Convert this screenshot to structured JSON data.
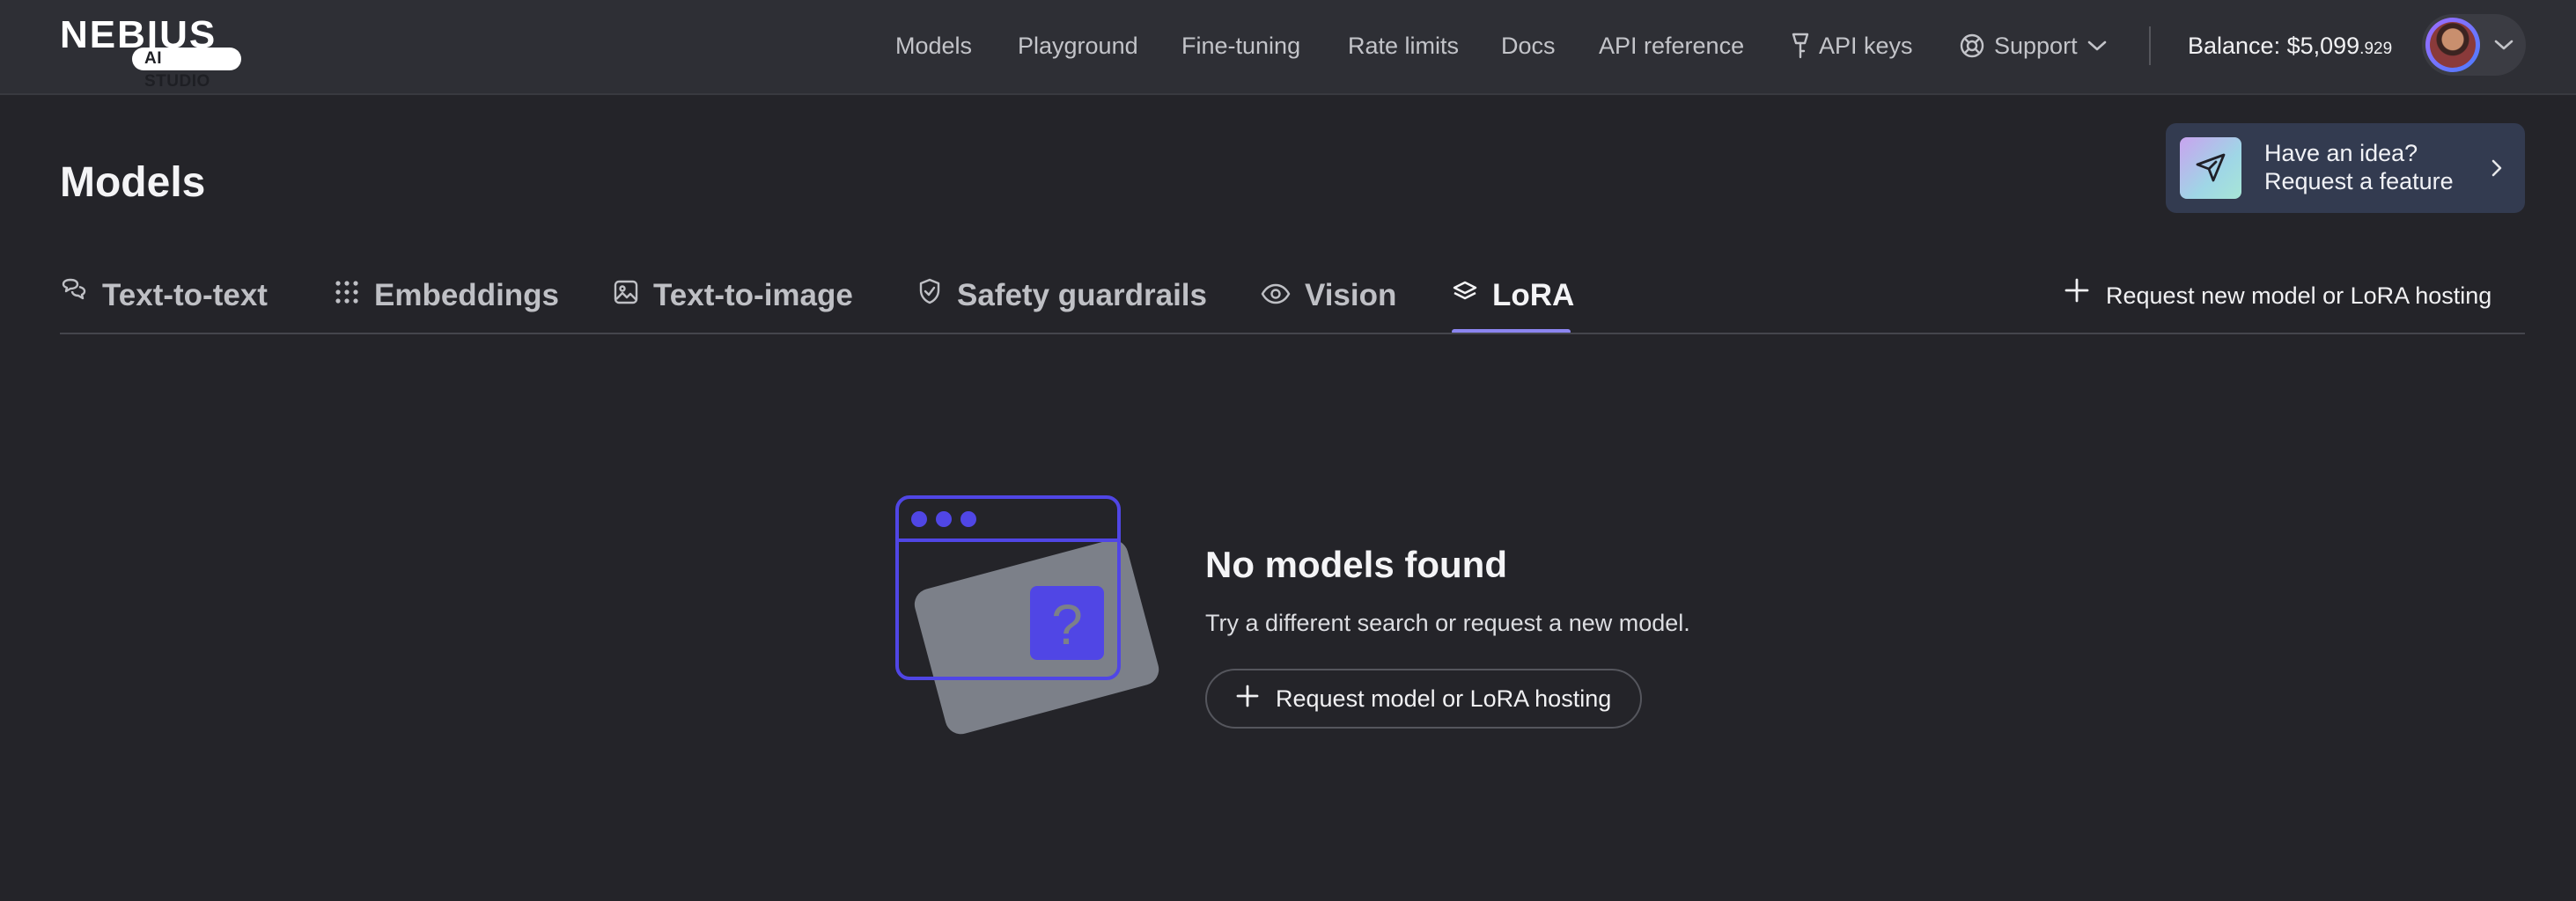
{
  "brand": {
    "name": "NEBIUS",
    "badge": "AI STUDIO"
  },
  "nav": {
    "models": "Models",
    "playground": "Playground",
    "fine_tuning": "Fine-tuning",
    "rate_limits": "Rate limits",
    "docs": "Docs",
    "api_reference": "API reference",
    "api_keys": "API keys",
    "support": "Support"
  },
  "account": {
    "balance_label": "Balance: $5,099",
    "balance_cents": ".929"
  },
  "feature_card": {
    "line1": "Have an idea?",
    "line2": "Request a feature"
  },
  "page": {
    "title": "Models"
  },
  "tabs": [
    {
      "label": "Text-to-text",
      "icon": "chat-bubbles-icon"
    },
    {
      "label": "Embeddings",
      "icon": "grid-dots-icon"
    },
    {
      "label": "Text-to-image",
      "icon": "image-icon"
    },
    {
      "label": "Safety guardrails",
      "icon": "shield-icon"
    },
    {
      "label": "Vision",
      "icon": "eye-icon"
    },
    {
      "label": "LoRA",
      "icon": "layers-icon",
      "active": true
    }
  ],
  "request_link": "Request new model or LoRA hosting",
  "empty_state": {
    "title": "No models found",
    "subtitle": "Try a different search or request a new model.",
    "button": "Request model or LoRA hosting"
  },
  "colors": {
    "background": "#242429",
    "topbar": "#2e2f35",
    "accent": "#8b85f0",
    "illustration_purple": "#5046e5",
    "card": "#333b50"
  }
}
